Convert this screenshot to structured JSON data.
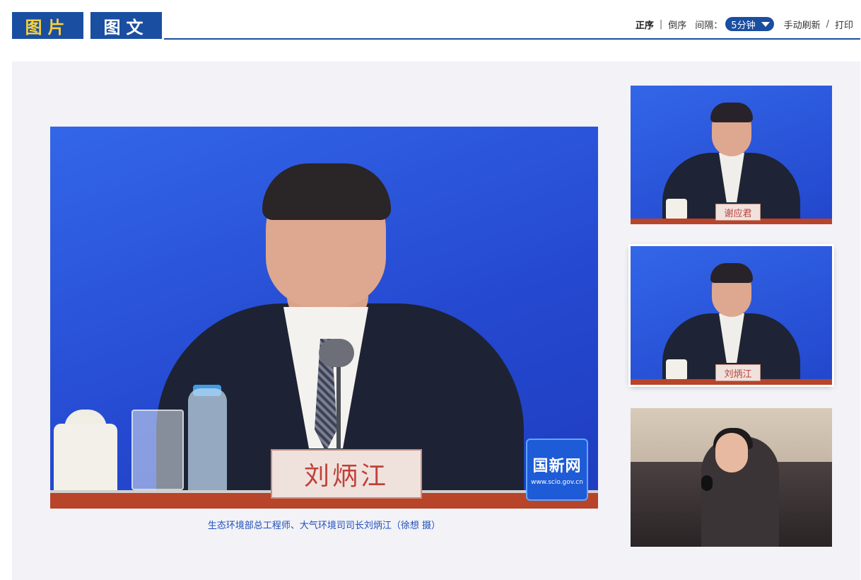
{
  "tabs": [
    {
      "label": "图片",
      "active": true
    },
    {
      "label": "图文",
      "active": false
    }
  ],
  "controls": {
    "order_asc": "正序",
    "order_desc": "倒序",
    "interval_label": "间隔：",
    "interval_value": "5分钟",
    "manual_refresh": "手动刷新",
    "print": "打印"
  },
  "main_photo": {
    "nameplate": "刘炳江",
    "logo_text": "国新网",
    "logo_url": "www.scio.gov.cn",
    "caption": "生态环境部总工程师、大气环境司司长刘炳江（徐想 摄）"
  },
  "thumbnails": [
    {
      "nameplate": "谢应君",
      "selected": false
    },
    {
      "nameplate": "刘炳江",
      "selected": true
    },
    {
      "nameplate": "",
      "selected": false
    }
  ],
  "colors": {
    "tab_bg": "#1a4ea1",
    "tab_active_text": "#f8d23a",
    "panel_bg": "#f2f2f7",
    "caption_text": "#2050b8"
  }
}
